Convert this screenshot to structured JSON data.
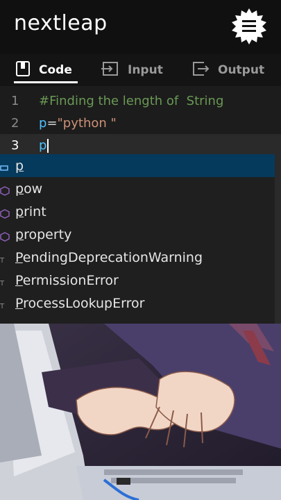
{
  "brand": {
    "logo_text": "nextleap"
  },
  "menu": {
    "icon": "hamburger-menu-icon",
    "badge_color": "#ffffff"
  },
  "tabs": [
    {
      "label": "Code",
      "icon": "book-icon",
      "active": true
    },
    {
      "label": "Input",
      "icon": "input-arrow-icon",
      "active": false
    },
    {
      "label": "Output",
      "icon": "output-arrow-icon",
      "active": false
    }
  ],
  "editor": {
    "lines": [
      {
        "number": "1",
        "text": "#Finding the length of  String"
      },
      {
        "number": "2",
        "var": "p",
        "op": "=",
        "str": "\"python \""
      },
      {
        "number": "3",
        "text": "p"
      }
    ]
  },
  "autocomplete": {
    "items": [
      {
        "match": "p",
        "rest": "",
        "kind": "variable"
      },
      {
        "match": "p",
        "rest": "ow",
        "kind": "function"
      },
      {
        "match": "p",
        "rest": "rint",
        "kind": "function"
      },
      {
        "match": "p",
        "rest": "roperty",
        "kind": "class"
      },
      {
        "match": "P",
        "rest": "endingDeprecationWarning",
        "kind": "class"
      },
      {
        "match": "P",
        "rest": "ermissionError",
        "kind": "class"
      },
      {
        "match": "P",
        "rest": "rocessLookupError",
        "kind": "class"
      }
    ],
    "selected_index": 0
  },
  "colors": {
    "comment": "#6a9955",
    "variable": "#4fc1ff",
    "string": "#ce9178",
    "selection": "#053a5c"
  }
}
